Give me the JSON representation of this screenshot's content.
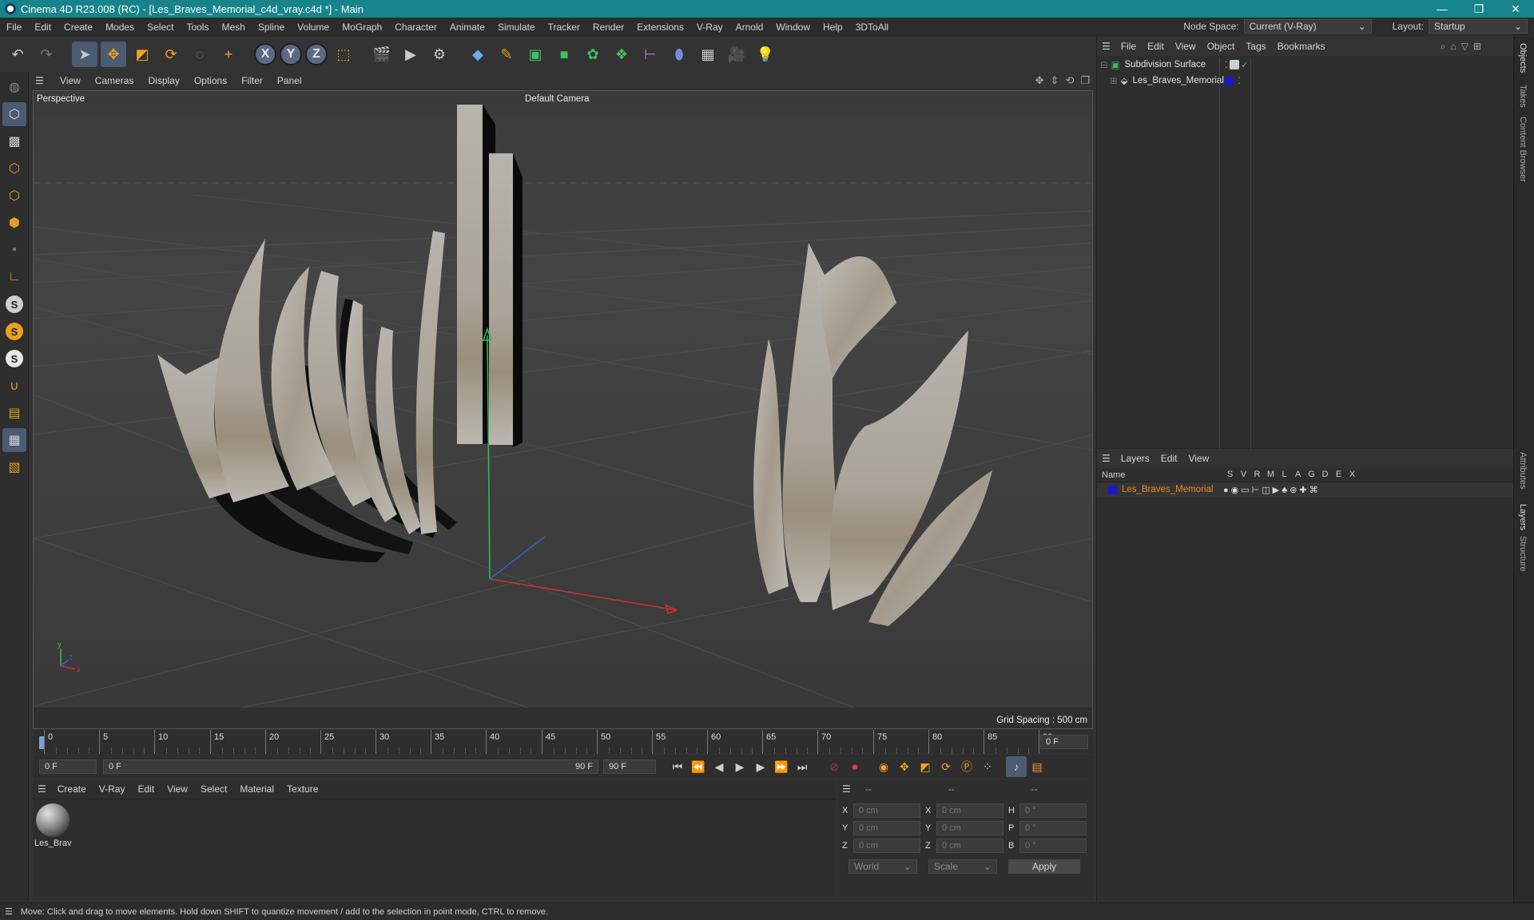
{
  "window": {
    "title": "Cinema 4D R23.008 (RC) - [Les_Braves_Memorial_c4d_vray.c4d *] - Main",
    "minimize": "—",
    "restore": "❐",
    "close": "✕"
  },
  "menubar": {
    "items": [
      "File",
      "Edit",
      "Create",
      "Modes",
      "Select",
      "Tools",
      "Mesh",
      "Spline",
      "Volume",
      "MoGraph",
      "Character",
      "Animate",
      "Simulate",
      "Tracker",
      "Render",
      "Extensions",
      "V-Ray",
      "Arnold",
      "Window",
      "Help",
      "3DToAll"
    ],
    "node_space_label": "Node Space:",
    "node_space_value": "Current (V-Ray)",
    "layout_label": "Layout:",
    "layout_value": "Startup"
  },
  "viewport": {
    "menu": [
      "View",
      "Cameras",
      "Display",
      "Options",
      "Filter",
      "Panel"
    ],
    "name": "Perspective",
    "camera": "Default Camera",
    "grid_spacing": "Grid Spacing : 500 cm"
  },
  "timeline": {
    "ticks": [
      "0",
      "5",
      "10",
      "15",
      "20",
      "25",
      "30",
      "35",
      "40",
      "45",
      "50",
      "55",
      "60",
      "65",
      "70",
      "75",
      "80",
      "85",
      "90"
    ],
    "current_frame": "0 F",
    "start_field": "0 F",
    "range_start": "0 F",
    "range_end": "90 F",
    "end_field": "90 F"
  },
  "material_panel": {
    "menu": [
      "Create",
      "V-Ray",
      "Edit",
      "View",
      "Select",
      "Material",
      "Texture"
    ],
    "material_name": "Les_Brav"
  },
  "coordinates": {
    "headers": [
      "--",
      "--",
      "--"
    ],
    "rows": [
      {
        "a": "X",
        "av": "0 cm",
        "b": "X",
        "bv": "0 cm",
        "c": "H",
        "cv": "0 °"
      },
      {
        "a": "Y",
        "av": "0 cm",
        "b": "Y",
        "bv": "0 cm",
        "c": "P",
        "cv": "0 °"
      },
      {
        "a": "Z",
        "av": "0 cm",
        "b": "Z",
        "bv": "0 cm",
        "c": "B",
        "cv": "0 °"
      }
    ],
    "mode1": "World",
    "mode2": "Scale",
    "apply": "Apply"
  },
  "objects_panel": {
    "menu": [
      "File",
      "Edit",
      "View",
      "Object",
      "Tags",
      "Bookmarks"
    ],
    "items": [
      "Subdivision Surface",
      "Les_Braves_Memorial"
    ]
  },
  "layers_panel": {
    "menu": [
      "Layers",
      "Edit",
      "View"
    ],
    "columns": [
      "Name",
      "S",
      "V",
      "R",
      "M",
      "L",
      "A",
      "G",
      "D",
      "E",
      "X"
    ],
    "layer_name": "Les_Braves_Memorial",
    "layer_color": "#1a1acc"
  },
  "side_tabs": [
    "Objects",
    "Takes",
    "Content Browser",
    "Attributes",
    "Layers",
    "Structure"
  ],
  "status": "Move: Click and drag to move elements. Hold down SHIFT to quantize movement / add to the selection in point mode, CTRL to remove.",
  "colors": {
    "accent": "#17848c",
    "selection": "#f08a1a",
    "axis_x": "#d03030",
    "axis_y": "#30c060",
    "axis_z": "#3060d0"
  }
}
